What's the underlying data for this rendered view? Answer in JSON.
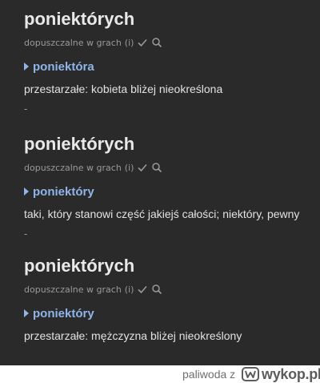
{
  "entries": [
    {
      "headword": "poniektórych",
      "status": "dopuszczalne w grach",
      "info": "(i)",
      "lemma": "poniektóra",
      "definition": "przestarzałe: kobieta bliżej nieokreślona",
      "separator": "-"
    },
    {
      "headword": "poniektórych",
      "status": "dopuszczalne w grach",
      "info": "(i)",
      "lemma": "poniektóry",
      "definition": "taki, który stanowi część jakiejś całości; niektóry, pewny",
      "separator": "-"
    },
    {
      "headword": "poniektórych",
      "status": "dopuszczalne w grach",
      "info": "(i)",
      "lemma": "poniektóry",
      "definition": "przestarzałe: mężczyzna bliżej nieokreślony"
    }
  ],
  "footer": {
    "author": "paliwoda",
    "connector": "z",
    "logo_text": "wykop.pl"
  },
  "icons": {
    "status_check": "check-icon",
    "status_search": "search-icon",
    "lemma_marker": "triangle-right-icon",
    "brand": "wykop-logo-icon"
  },
  "colors": {
    "background": "#2a2a2a",
    "headword": "#e9e9e9",
    "link": "#8fb5e8",
    "muted": "#9a9a9a",
    "text": "#e2e2e2"
  }
}
